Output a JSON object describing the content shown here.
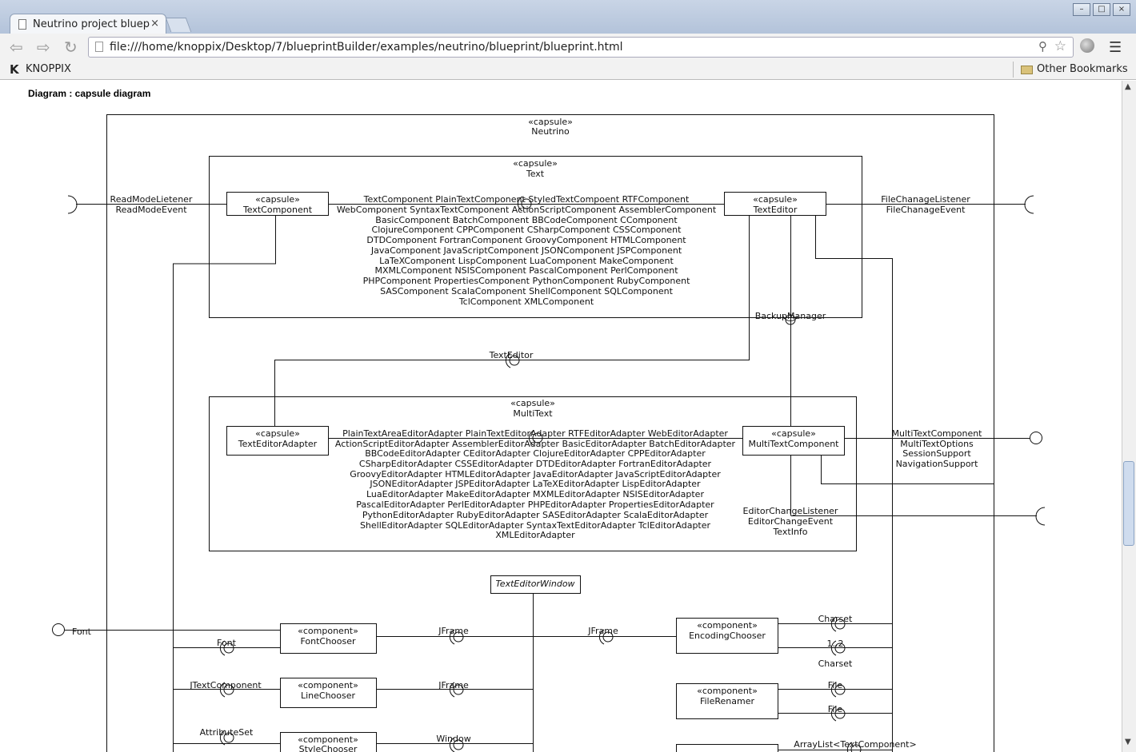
{
  "browser": {
    "tab_title": "Neutrino project bluep",
    "tab_close": "×",
    "url": "file:///home/knoppix/Desktop/7/blueprintBuilder/examples/neutrino/blueprint/blueprint.html",
    "bookmark_item": "KNOPPIX",
    "other_bookmarks": "Other Bookmarks"
  },
  "diagram": {
    "title": "Diagram : capsule diagram",
    "capsule_stereotype": "«capsule»",
    "component_stereotype": "«component»",
    "neutrino": "Neutrino",
    "text": "Text",
    "text_component": "TextComponent",
    "text_editor": "TextEditor",
    "multitext": "MultiText",
    "text_editor_adapter": "TextEditorAdapter",
    "multi_text_component": "MultiTextComponent",
    "text_editor_window": "TextEditorWindow",
    "font_chooser": "FontChooser",
    "line_chooser": "LineChooser",
    "style_chooser": "StyleChooser",
    "encoding_chooser": "EncodingChooser",
    "file_renamer": "FileRenamer",
    "left_port_lines": [
      "ReadModeLietener",
      "ReadModeEvent"
    ],
    "right_port_lines": [
      "FileChanageListener",
      "FileChanageEvent"
    ],
    "text_components_lines": [
      "TextComponent PlainTextComponent StyledTextCompoent RTFComponent",
      "WebComponent SyntaxTextComponent ActionScriptComponent AssemblerComponent",
      "BasicComponent BatchComponent BBCodeComponent CComponent",
      "ClojureComponent CPPComponent CSharpComponent CSSComponent",
      "DTDComponent FortranComponent GroovyComponent HTMLComponent",
      "JavaComponent JavaScriptComponent JSONComponent JSPComponent",
      "LaTeXComponent LispComponent LuaComponent MakeComponent",
      "MXMLComponent NSISComponent PascalComponent PerlComponent",
      "PHPComponent PropertiesComponent PythonComponent RubyComponent",
      "SASComponent ScalaComponent ShellComponent SQLComponent",
      "TclComponent XMLComponent"
    ],
    "backup_manager": "BackupManager",
    "text_editor_port": "TextEditor",
    "adapter_lines": [
      "PlainTextAreaEditorAdapter PlainTextEditorAdapter RTFEditorAdapter WebEditorAdapter",
      "ActionScriptEditorAdapter AssemblerEditorAdapter BasicEditorAdapter BatchEditorAdapter",
      "BBCodeEditorAdapter CEditorAdapter ClojureEditorAdapter CPPEditorAdapter",
      "CSharpEditorAdapter CSSEditorAdapter DTDEditorAdapter FortranEditorAdapter",
      "GroovyEditorAdapter HTMLEditorAdapter JavaEditorAdapter JavaScriptEditorAdapter",
      "JSONEditorAdapter JSPEditorAdapter LaTeXEditorAdapter LispEditorAdapter",
      "LuaEditorAdapter MakeEditorAdapter MXMLEditorAdapter NSISEditorAdapter",
      "PascalEditorAdapter PerlEditorAdapter PHPEditorAdapter PropertiesEditorAdapter",
      "PythonEditorAdapter RubyEditorAdapter SASEditorAdapter ScalaEditorAdapter",
      "ShellEditorAdapter SQLEditorAdapter SyntaxTextEditorAdapter TclEditorAdapter",
      "XMLEditorAdapter"
    ],
    "multi_port_lines": [
      "MultiTextComponent",
      "MultiTextOptions",
      "SessionSupport",
      "NavigationSupport"
    ],
    "editor_change_lines": [
      "EditorChangeListener",
      "EditorChangeEvent",
      "TextInfo"
    ],
    "font": "Font",
    "jframe": "JFrame",
    "jtext_component": "JTextComponent",
    "attribute_set": "AttributeSet",
    "window": "Window",
    "charset": "Charset",
    "multiplicity": "1..2",
    "file": "File",
    "array_list": "ArrayList<TextComponent>"
  }
}
